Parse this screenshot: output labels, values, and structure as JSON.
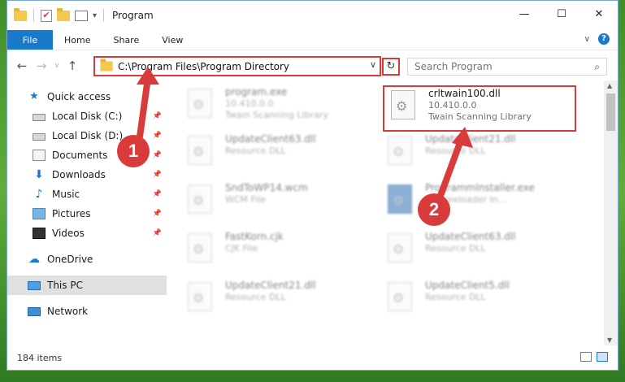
{
  "window": {
    "title": "Program",
    "controls": {
      "minimize": "—",
      "maximize": "☐",
      "close": "✕"
    }
  },
  "ribbon": {
    "tabs": [
      "File",
      "Home",
      "Share",
      "View"
    ],
    "help": "?"
  },
  "address": {
    "path": "C:\\Program Files\\Program Directory",
    "search_placeholder": "Search Program"
  },
  "nav_pane": {
    "items": [
      {
        "label": "Quick access",
        "icon": "star-icon"
      },
      {
        "label": "Local Disk (C:)",
        "icon": "disk-icon",
        "pinned": true
      },
      {
        "label": "Local Disk (D:)",
        "icon": "disk-icon",
        "pinned": true
      },
      {
        "label": "Documents",
        "icon": "documents-icon",
        "pinned": true
      },
      {
        "label": "Downloads",
        "icon": "downloads-icon",
        "pinned": true
      },
      {
        "label": "Music",
        "icon": "music-icon",
        "pinned": true
      },
      {
        "label": "Pictures",
        "icon": "pictures-icon",
        "pinned": true
      },
      {
        "label": "Videos",
        "icon": "videos-icon",
        "pinned": true
      },
      {
        "label": "OneDrive",
        "icon": "cloud-icon"
      },
      {
        "label": "This PC",
        "icon": "pc-icon",
        "selected": true
      },
      {
        "label": "Network",
        "icon": "network-icon"
      }
    ]
  },
  "files": {
    "highlighted": {
      "name": "crltwain100.dll",
      "version": "10.410.0.0",
      "description": "Twain Scanning Library"
    },
    "others": [
      {
        "name": "program.exe",
        "line2": "10.410.0.0",
        "line3": "Twain Scanning Library"
      },
      {
        "name": "UpdateClient63.dll",
        "line2": "Resource DLL"
      },
      {
        "name": "UpdateClient21.dll",
        "line2": "Resource DLL"
      },
      {
        "name": "SndToWP14.wcm",
        "line2": "WCM File"
      },
      {
        "name": "ProgrammInstaller.exe",
        "line2": "BT Freeloader In..."
      },
      {
        "name": "FastKorn.cjk",
        "line2": "CJK File"
      },
      {
        "name": "UpdateClient63.dll",
        "line2": "Resource DLL"
      },
      {
        "name": "UpdateClient21.dll",
        "line2": "Resource DLL"
      },
      {
        "name": "UpdateClient5.dll",
        "line2": "Resource DLL"
      }
    ]
  },
  "status": {
    "count": "184 items"
  },
  "annotations": {
    "step1": "1",
    "step2": "2",
    "color": "#d93a3a"
  }
}
